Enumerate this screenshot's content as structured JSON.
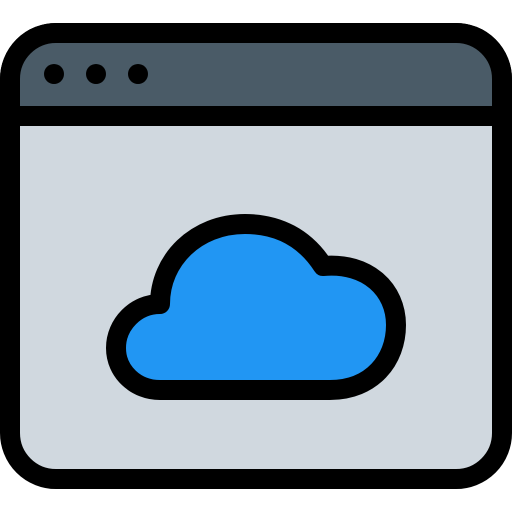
{
  "icon": {
    "name": "cloud-browser-window-icon",
    "parts": {
      "window": "browser-window-icon",
      "dots": "window-dots-icon",
      "cloud": "cloud-icon"
    }
  },
  "colors": {
    "outline": "#000000",
    "title_bar": "#4a5b67",
    "window_body": "#d0d8df",
    "cloud_fill": "#2196f3",
    "window_dots": "#000000",
    "background": "#ffffff"
  }
}
